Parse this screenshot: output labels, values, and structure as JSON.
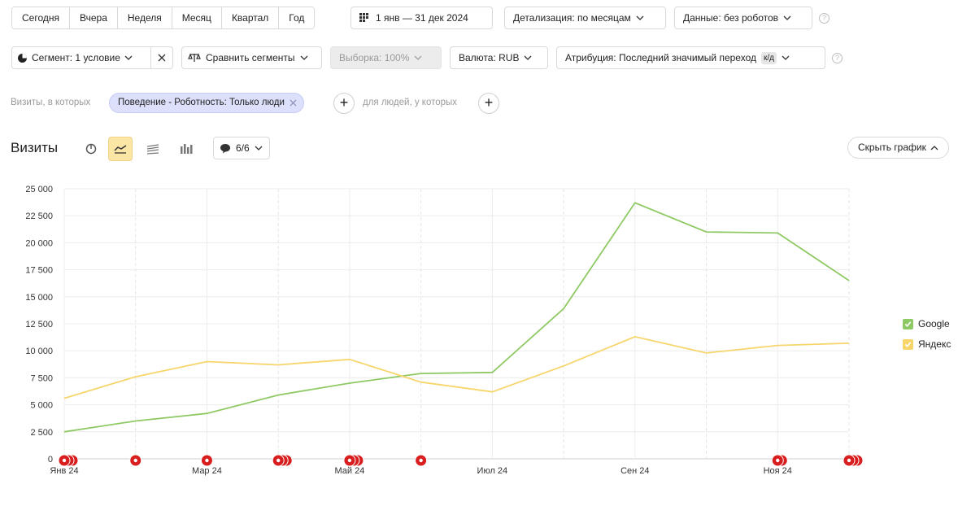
{
  "toolbar": {
    "periods": [
      "Сегодня",
      "Вчера",
      "Неделя",
      "Месяц",
      "Квартал",
      "Год"
    ],
    "date_range": "1 янв — 31 дек 2024",
    "detail": "Детализация: по месяцам",
    "data_filter": "Данные: без роботов"
  },
  "row2": {
    "segment": "Сегмент: 1 условие",
    "compare": "Сравнить сегменты",
    "sample": "Выборка: 100%",
    "currency": "Валюта: RUB",
    "attribution": "Атрибуция: Последний значимый переход",
    "attribution_badge": "к/д"
  },
  "filters": {
    "visits_label": "Визиты, в которых",
    "chip": "Поведение - Роботность: Только люди",
    "people_label": "для людей, у которых"
  },
  "chart_header": {
    "title": "Визиты",
    "comments": "6/6",
    "hide": "Скрыть график"
  },
  "colors": {
    "google": "#8fc964",
    "yandex": "#f7d56b",
    "marker": "#d81e1e",
    "active_tool": "#fbe6a6"
  },
  "chart_data": {
    "type": "line",
    "x": [
      "2024-01",
      "2024-02",
      "2024-03",
      "2024-04",
      "2024-05",
      "2024-06",
      "2024-07",
      "2024-08",
      "2024-09",
      "2024-10",
      "2024-11",
      "2024-12"
    ],
    "x_tick_labels": {
      "0": "Янв 24",
      "2": "Мар 24",
      "4": "Май 24",
      "6": "Июл 24",
      "8": "Сен 24",
      "10": "Ноя 24"
    },
    "y_ticks": [
      "0",
      "2 500",
      "5 000",
      "7 500",
      "10 000",
      "12 500",
      "15 000",
      "17 500",
      "20 000",
      "22 500",
      "25 000"
    ],
    "ylim": [
      0,
      25000
    ],
    "grid": true,
    "legend": "right",
    "series": [
      {
        "name": "Google",
        "color": "#8fc964",
        "values": [
          2500,
          3500,
          4200,
          5900,
          7000,
          7900,
          8000,
          13900,
          23700,
          21000,
          20900,
          16500
        ]
      },
      {
        "name": "Яндекс",
        "color": "#f7d56b",
        "values": [
          5600,
          7600,
          9000,
          8700,
          9200,
          7100,
          6200,
          8600,
          11300,
          9800,
          10500,
          10700
        ]
      }
    ],
    "annotation_markers": [
      {
        "month": 0,
        "count": 3
      },
      {
        "month": 1,
        "count": 1
      },
      {
        "month": 2,
        "count": 1
      },
      {
        "month": 3,
        "count": 3
      },
      {
        "month": 4,
        "count": 3
      },
      {
        "month": 5,
        "count": 1
      },
      {
        "month": 10,
        "count": 2
      },
      {
        "month": 11,
        "count": 3
      }
    ]
  }
}
